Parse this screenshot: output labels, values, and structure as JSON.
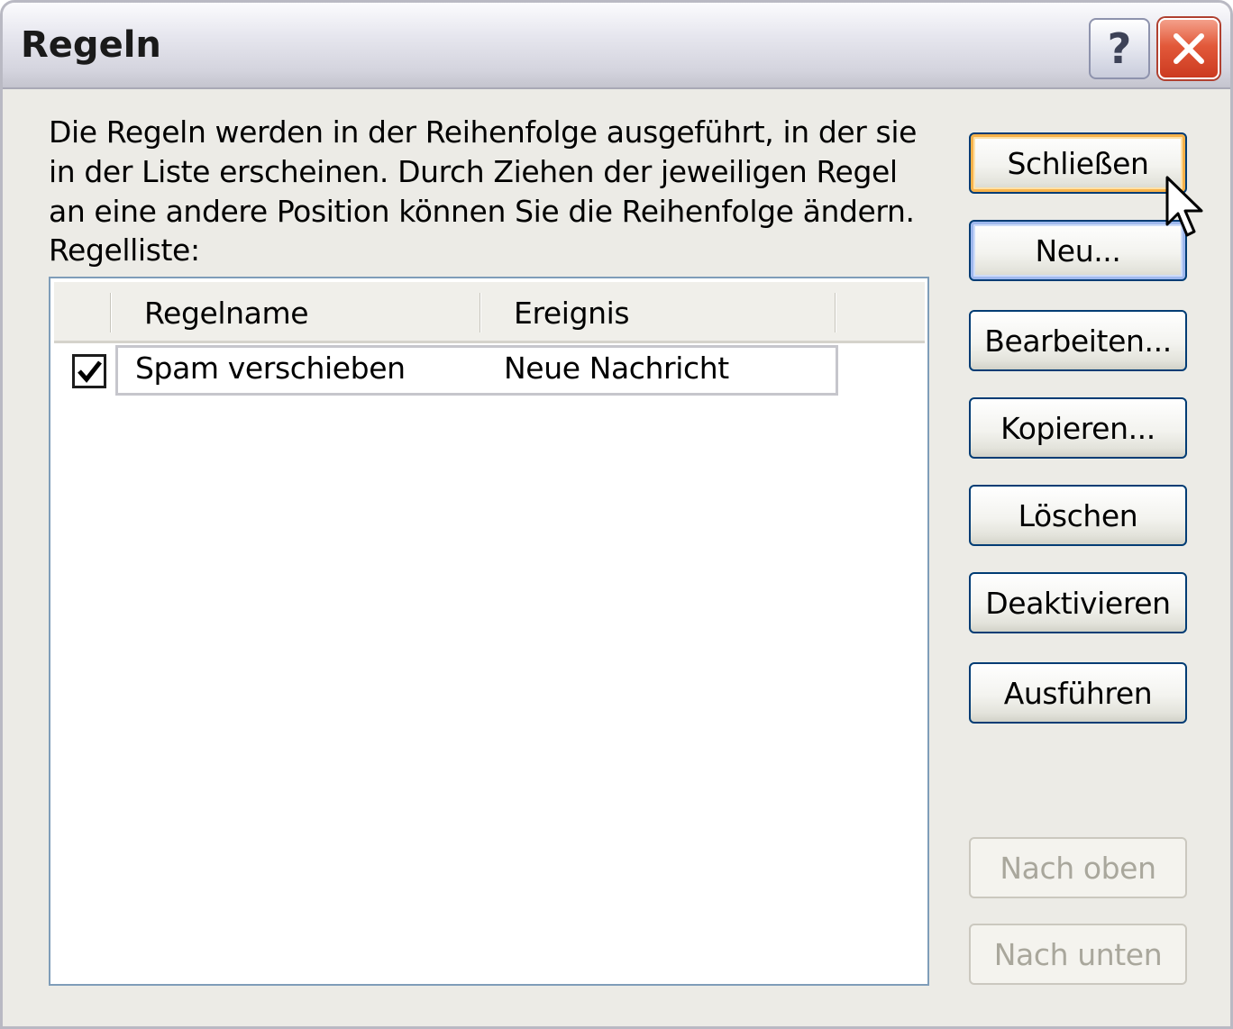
{
  "window": {
    "title": "Regeln",
    "help_label": "?",
    "close_icon": "close-icon"
  },
  "description": "Die Regeln werden in der Reihenfolge ausgeführt, in der sie in der Liste erscheinen. Durch Ziehen der jeweiligen Regel an eine andere Position können Sie die Reihenfolge ändern.",
  "list_label": "Regelliste:",
  "listview": {
    "columns": [
      "Regelname",
      "Ereignis"
    ],
    "rows": [
      {
        "checked": true,
        "name": "Spam verschieben",
        "event": "Neue Nachricht"
      }
    ]
  },
  "buttons": {
    "close": "Schließen",
    "new": "Neu...",
    "edit": "Bearbeiten...",
    "copy": "Kopieren...",
    "delete": "Löschen",
    "deactivate": "Deaktivieren",
    "run": "Ausführen",
    "move_up": "Nach oben",
    "move_down": "Nach unten"
  },
  "colors": {
    "dialog_bg": "#ecebe6",
    "button_border": "#003c74",
    "default_button_highlight": "#f7b24a",
    "close_button_red": "#e2593a",
    "list_border": "#7f9db9"
  }
}
